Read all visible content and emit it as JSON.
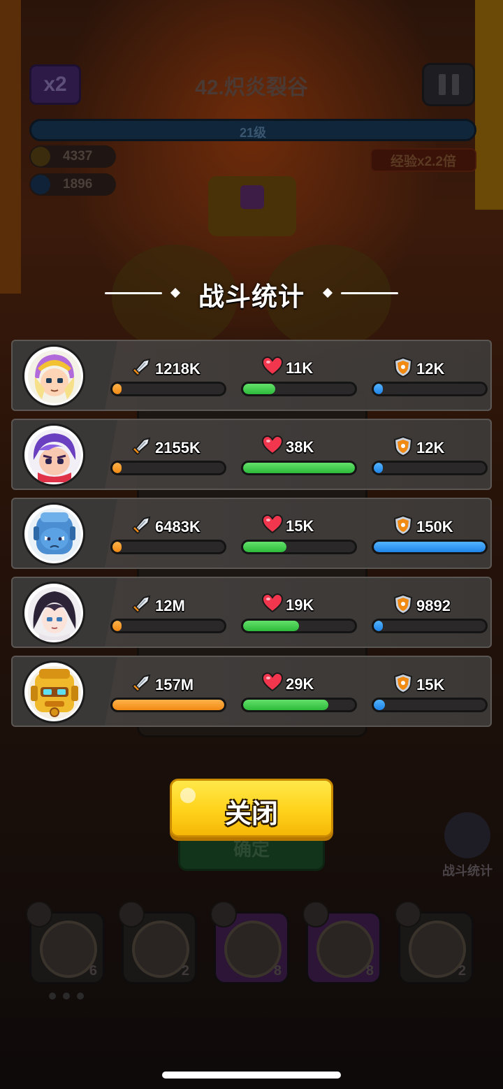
{
  "background": {
    "multiplier_badge": "x2",
    "level_title": "42.炽炎裂谷",
    "xp_level": "21级",
    "gold": "4337",
    "gems": "1896",
    "exp_boost": "经验x2.2倍",
    "confirm_button": "确定",
    "battle_stats_shortcut": "战斗统计",
    "skill_slots": [
      {
        "count": "6",
        "color": "dark"
      },
      {
        "count": "2",
        "color": "dark"
      },
      {
        "count": "8",
        "color": "purple"
      },
      {
        "count": "8",
        "color": "purple"
      },
      {
        "count": "2",
        "color": "dark"
      }
    ]
  },
  "modal": {
    "title": "战斗统计",
    "close_button": "关闭",
    "rows": [
      {
        "avatar": "hero-blonde-gold-helmet",
        "damage": "1218K",
        "healing": "11K",
        "shield": "12K",
        "damage_ratio": 0.0,
        "healing_ratio": 0.29,
        "shield_ratio": 0.08
      },
      {
        "avatar": "hero-purple-hair",
        "damage": "2155K",
        "healing": "38K",
        "shield": "12K",
        "damage_ratio": 0.0,
        "healing_ratio": 1.0,
        "shield_ratio": 0.08
      },
      {
        "avatar": "hero-blue-robot",
        "damage": "6483K",
        "healing": "15K",
        "shield": "150K",
        "damage_ratio": 0.04,
        "healing_ratio": 0.39,
        "shield_ratio": 1.0
      },
      {
        "avatar": "hero-dark-hair",
        "damage": "12M",
        "healing": "19K",
        "shield": "9892",
        "damage_ratio": 0.08,
        "healing_ratio": 0.5,
        "shield_ratio": 0.07
      },
      {
        "avatar": "hero-gold-robot",
        "damage": "157M",
        "healing": "29K",
        "shield": "15K",
        "damage_ratio": 1.0,
        "healing_ratio": 0.76,
        "shield_ratio": 0.1
      }
    ]
  },
  "colors": {
    "damage_bar": "#f28a14",
    "healing_bar": "#2dbb3a",
    "shield_bar": "#1f84e8",
    "close_button": "#ffd21a"
  }
}
